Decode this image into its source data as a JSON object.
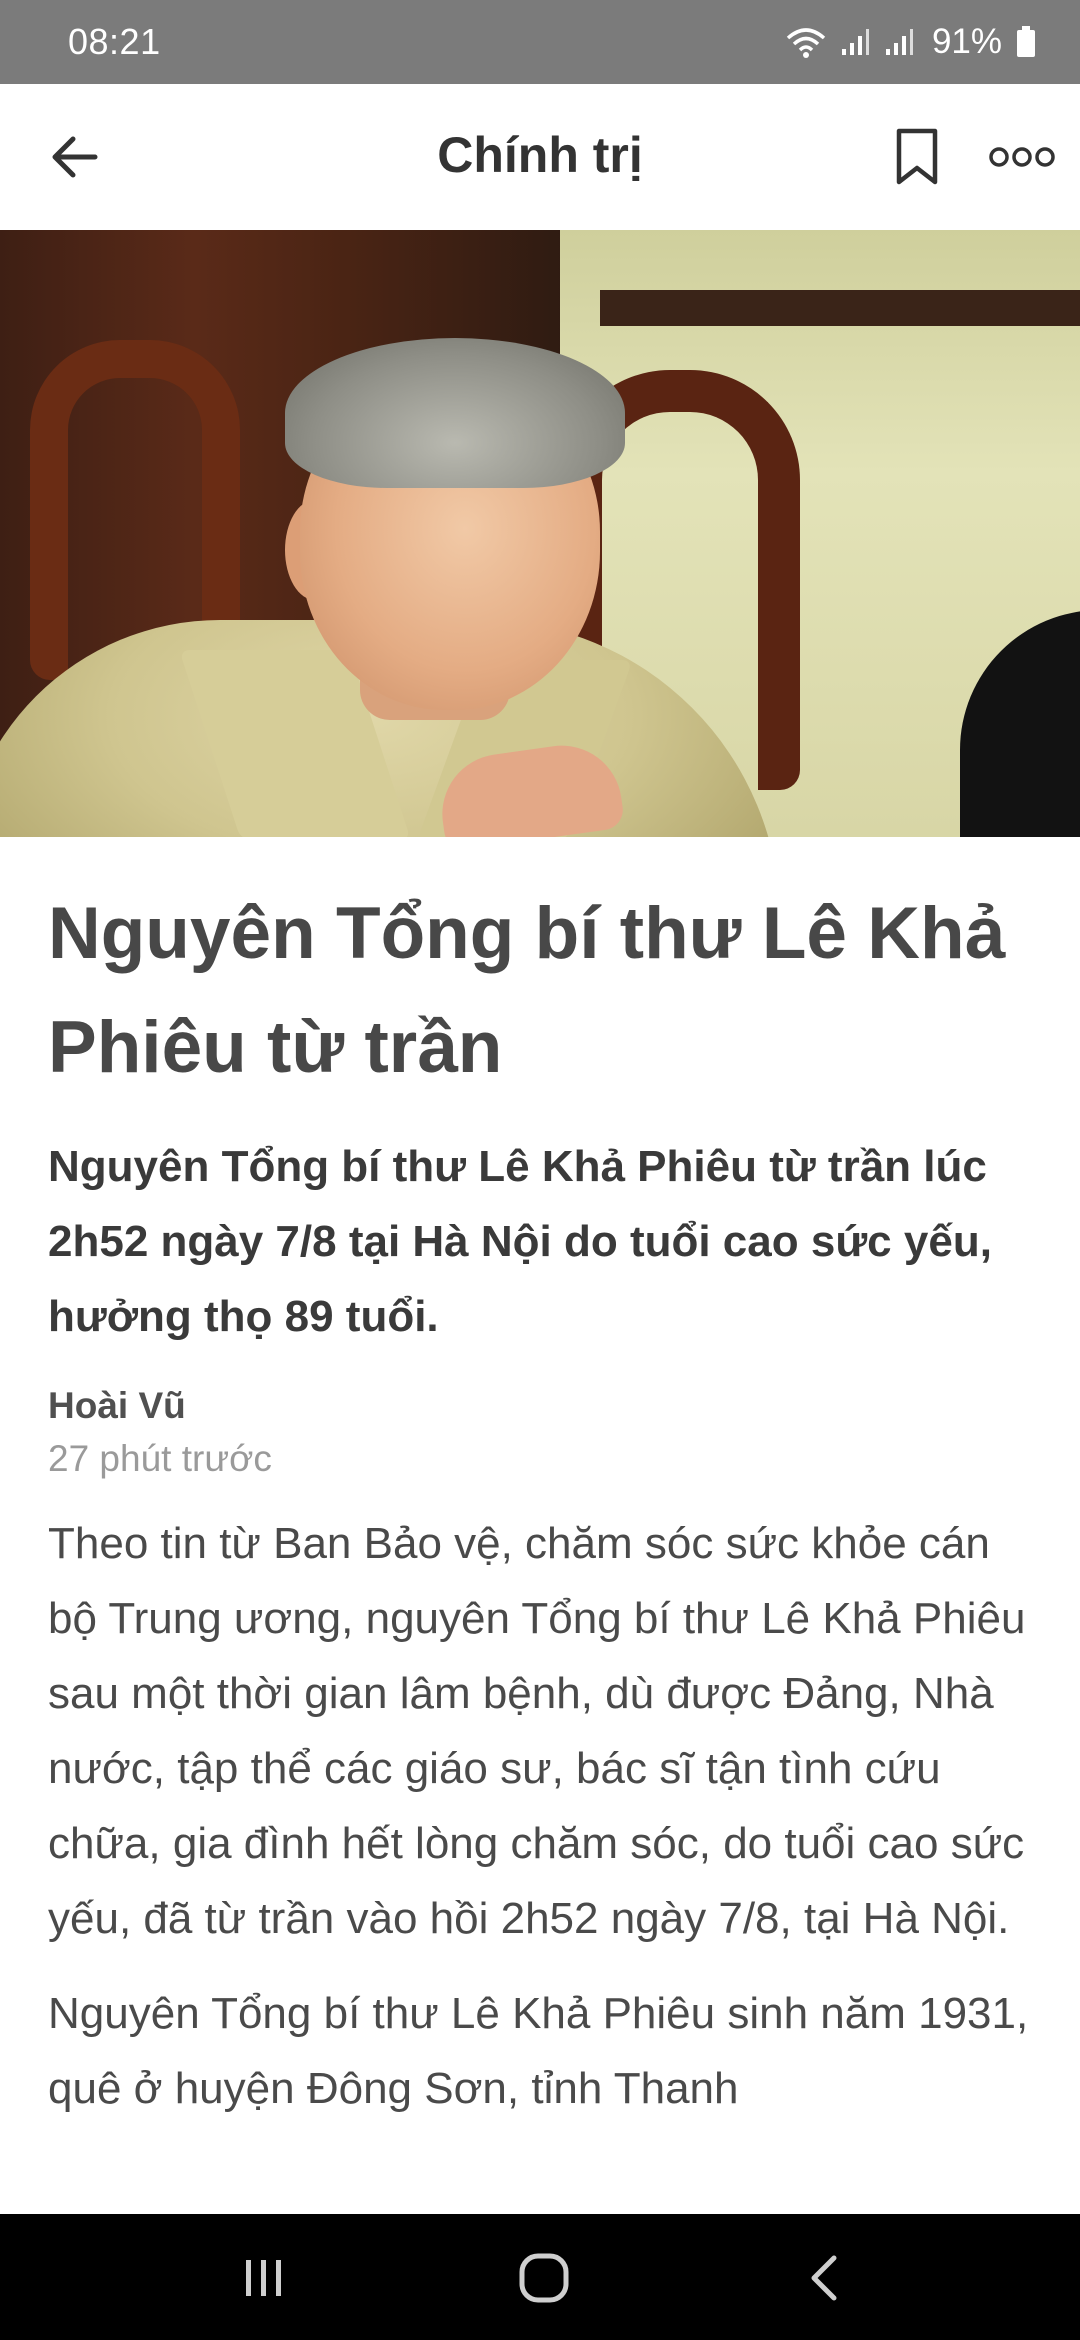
{
  "status_bar": {
    "time": "08:21",
    "battery_percent": "91%",
    "icons": [
      "wifi-icon",
      "signal-icon",
      "signal-icon",
      "battery-icon"
    ]
  },
  "app_bar": {
    "title": "Chính trị",
    "icons": [
      "back-arrow-icon",
      "bookmark-icon",
      "more-options-icon"
    ]
  },
  "hero_image": {
    "description_icon": "article-photo"
  },
  "article": {
    "headline": "Nguyên Tổng bí thư Lê Khả Phiêu từ trần",
    "sapo": "Nguyên Tổng bí thư Lê Khả Phiêu từ trần lúc 2h52 ngày 7/8 tại Hà Nội do tuổi cao sức yếu, hưởng thọ 89 tuổi.",
    "author": "Hoài Vũ",
    "published": "27 phút trước",
    "paragraphs": [
      "Theo tin từ Ban Bảo vệ, chăm sóc sức khỏe cán bộ Trung ương, nguyên Tổng bí thư Lê Khả Phiêu sau một thời gian lâm bệnh, dù được Đảng, Nhà nước, tập thể các giáo sư, bác sĩ tận tình cứu chữa, gia đình hết lòng chăm sóc, do tuổi cao sức yếu, đã từ trần vào hồi 2h52 ngày 7/8, tại Hà Nội.",
      "Nguyên Tổng bí thư Lê Khả Phiêu sinh năm 1931, quê ở huyện Đông Sơn, tỉnh Thanh"
    ]
  },
  "nav_bar": {
    "icons": [
      "recent-apps-icon",
      "home-icon",
      "back-icon"
    ]
  }
}
